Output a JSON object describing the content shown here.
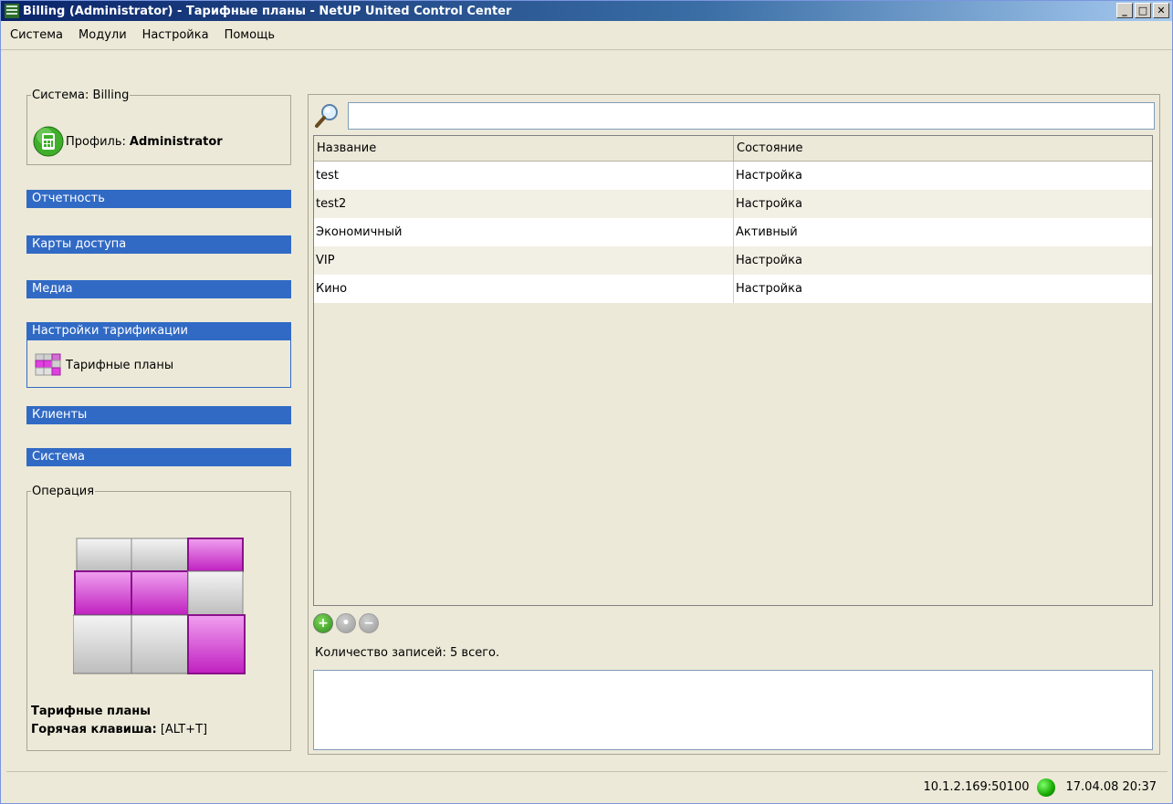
{
  "window": {
    "title": "Billing (Administrator) - Тарифные планы - NetUP United Control Center"
  },
  "menu": [
    "Система",
    "Модули",
    "Настройка",
    "Помощь"
  ],
  "system_box": {
    "legend": "Система: Billing",
    "profile_label": "Профиль:",
    "profile_value": "Administrator"
  },
  "nav": {
    "sections": [
      "Отчетность",
      "Карты доступа",
      "Медиа",
      "Настройки тарификации",
      "Клиенты",
      "Система"
    ],
    "subitem": "Тарифные планы"
  },
  "operation": {
    "legend": "Операция",
    "name": "Тарифные планы",
    "hotkey_label": "Горячая клавиша:",
    "hotkey_value": "[ALT+T]"
  },
  "search": {
    "value": ""
  },
  "table": {
    "columns": [
      "Название",
      "Состояние"
    ],
    "rows": [
      [
        "test",
        "Настройка"
      ],
      [
        "test2",
        "Настройка"
      ],
      [
        "Экономичный",
        "Активный"
      ],
      [
        "VIP",
        "Настройка"
      ],
      [
        "Кино",
        "Настройка"
      ]
    ]
  },
  "footer": {
    "count_text": "Количество записей: 5 всего."
  },
  "status": {
    "address": "10.1.2.169:50100",
    "datetime": "17.04.08 20:37"
  },
  "colors": {
    "titlebar": "#0a246a",
    "section": "#316ac5",
    "status_ok": "#17a800"
  }
}
